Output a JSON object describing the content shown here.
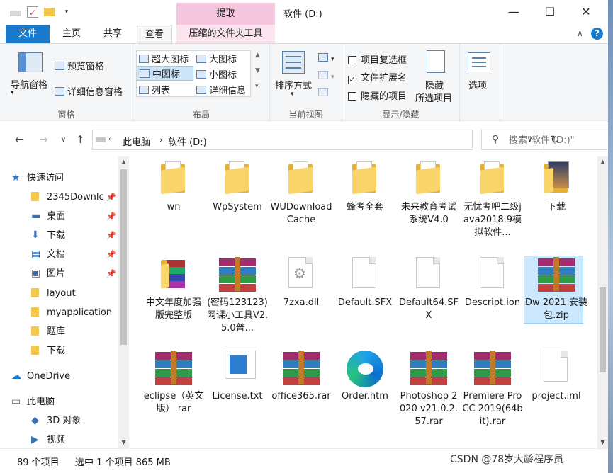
{
  "window": {
    "title": "软件 (D:)",
    "context_tab_header": "提取",
    "minimize": "—",
    "maximize": "☐",
    "close": "✕"
  },
  "tabs": [
    {
      "label": "文件"
    },
    {
      "label": "主页"
    },
    {
      "label": "共享"
    },
    {
      "label": "查看"
    },
    {
      "label": "压缩的文件夹工具"
    }
  ],
  "ribbon": {
    "pane_group": {
      "label": "窗格",
      "nav_pane": "导航窗格",
      "preview_pane": "预览窗格",
      "details_pane": "详细信息窗格"
    },
    "layout_group": {
      "label": "布局",
      "items": [
        "超大图标",
        "大图标",
        "中图标",
        "小图标",
        "列表",
        "详细信息"
      ],
      "selected": "中图标"
    },
    "current_view_group": {
      "label": "当前视图",
      "sort_by": "排序方式"
    },
    "show_hide_group": {
      "label": "显示/隐藏",
      "item_checkboxes": "项目复选框",
      "file_extensions": "文件扩展名",
      "hidden_items": "隐藏的项目",
      "hide_selected": "隐藏",
      "hide_selected_2": "所选项目",
      "checked": [
        false,
        true,
        false
      ]
    },
    "options_group": {
      "options": "选项"
    }
  },
  "address": {
    "crumbs": [
      "此电脑",
      "软件 (D:)"
    ],
    "search_placeholder": "搜索\"软件 (D:)\""
  },
  "nav": {
    "items": [
      {
        "label": "快速访问",
        "icon": "star-icon",
        "pinned": false
      },
      {
        "label": "2345Downlc",
        "icon": "folder-icon",
        "pinned": true
      },
      {
        "label": "桌面",
        "icon": "desktop-icon",
        "pinned": true
      },
      {
        "label": "下载",
        "icon": "download-icon",
        "pinned": true
      },
      {
        "label": "文档",
        "icon": "document-icon",
        "pinned": true
      },
      {
        "label": "图片",
        "icon": "picture-icon",
        "pinned": true
      },
      {
        "label": "layout",
        "icon": "folder-icon",
        "pinned": false
      },
      {
        "label": "myapplication",
        "icon": "folder-icon",
        "pinned": false
      },
      {
        "label": "题库",
        "icon": "folder-icon",
        "pinned": false
      },
      {
        "label": "下载",
        "icon": "folder-icon",
        "pinned": false
      },
      {
        "label": "OneDrive",
        "icon": "cloud-icon",
        "pinned": false
      },
      {
        "label": "此电脑",
        "icon": "computer-icon",
        "pinned": false
      },
      {
        "label": "3D 对象",
        "icon": "cube-icon",
        "pinned": false
      },
      {
        "label": "视频",
        "icon": "video-icon",
        "pinned": false
      }
    ]
  },
  "files": [
    {
      "name": "wn",
      "type": "folder"
    },
    {
      "name": "WpSystem",
      "type": "folder"
    },
    {
      "name": "WUDownloadCache",
      "type": "folder"
    },
    {
      "name": "蜂考全套",
      "type": "folder"
    },
    {
      "name": "未来教育考试系统V4.0",
      "type": "folder"
    },
    {
      "name": "无忧考吧二级java2018.9模拟软件...",
      "type": "folder"
    },
    {
      "name": "下载",
      "type": "folder-image"
    },
    {
      "name": "中文年度加强版完整版",
      "type": "folder-rar"
    },
    {
      "name": "(密码123123)网课小工具V2.5.0普...",
      "type": "rar"
    },
    {
      "name": "7zxa.dll",
      "type": "dll"
    },
    {
      "name": "Default.SFX",
      "type": "doc"
    },
    {
      "name": "Default64.SFX",
      "type": "doc"
    },
    {
      "name": "Descript.ion",
      "type": "doc"
    },
    {
      "name": "Dw 2021 安装包.zip",
      "type": "rar",
      "selected": true
    },
    {
      "name": "eclipse（英文版）.rar",
      "type": "rar"
    },
    {
      "name": "License.txt",
      "type": "txt"
    },
    {
      "name": "office365.rar",
      "type": "rar"
    },
    {
      "name": "Order.htm",
      "type": "edge"
    },
    {
      "name": "Photoshop 2020 v21.0.2.57.rar",
      "type": "rar"
    },
    {
      "name": "Premiere Pro CC 2019(64bit).rar",
      "type": "rar"
    },
    {
      "name": "project.iml",
      "type": "doc"
    }
  ],
  "status": {
    "count": "89 个项目",
    "selection": "选中 1 个项目 865 MB"
  },
  "watermark": "CSDN @78岁大龄程序员",
  "colors": {
    "accent": "#1979ca",
    "context_tab": "#f5c6dd",
    "selection": "#cce8ff"
  }
}
